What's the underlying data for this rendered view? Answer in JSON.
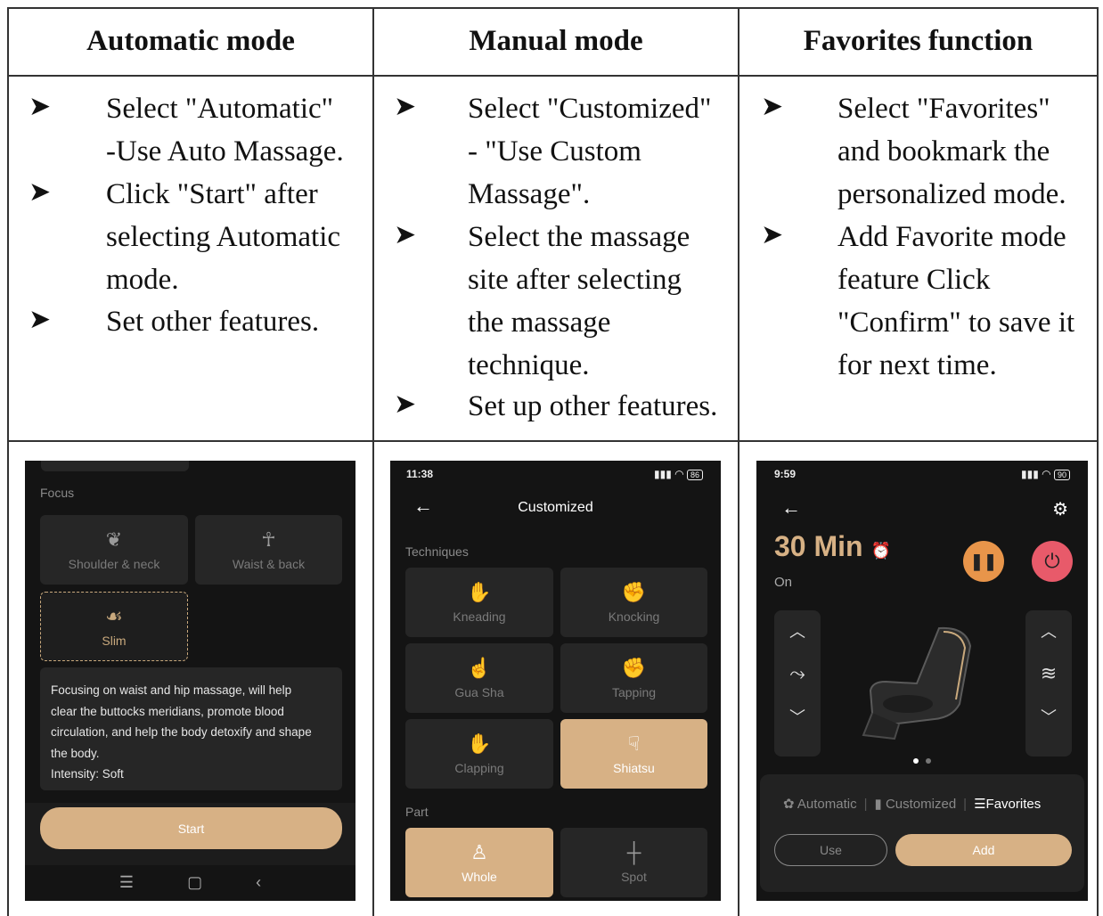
{
  "columns": [
    {
      "header": "Automatic mode",
      "bullets": [
        [
          "Select \"Automatic\"",
          "-Use Auto Massage."
        ],
        [
          "Click \"Start\" after",
          "selecting Automatic",
          "mode."
        ],
        [
          "Set other features."
        ]
      ]
    },
    {
      "header": "Manual mode",
      "bullets": [
        [
          "Select \"Customized\"",
          "- \"Use Custom",
          "Massage\"."
        ],
        [
          "Select the massage",
          "site after selecting",
          "the massage",
          "technique."
        ],
        [
          "Set up other features."
        ]
      ]
    },
    {
      "header": "Favorites function",
      "bullets": [
        [
          "Select \"Favorites\"",
          "and bookmark the",
          "personalized mode."
        ],
        [
          "Add Favorite mode",
          "feature Click",
          "\"Confirm\" to save it",
          "for next time."
        ]
      ]
    }
  ],
  "phone1": {
    "focus_label": "Focus",
    "cards": [
      "Shoulder & neck",
      "Waist & back",
      "Slim"
    ],
    "description": [
      "Focusing on waist and hip massage, will help",
      "clear the buttocks meridians, promote blood",
      "circulation, and help the body detoxify and shape",
      "the body.",
      "Intensity: Soft"
    ],
    "start_label": "Start",
    "nav": [
      "☰",
      "▢",
      "‹"
    ]
  },
  "phone2": {
    "time": "11:38",
    "battery": "86",
    "title": "Customized",
    "techniques_label": "Techniques",
    "techniques": [
      "Kneading",
      "Knocking",
      "Gua Sha",
      "Tapping",
      "Clapping",
      "Shiatsu"
    ],
    "part_label": "Part",
    "parts": [
      "Whole",
      "Spot"
    ]
  },
  "phone3": {
    "time": "9:59",
    "battery": "90",
    "duration": "30 Min",
    "state": "On",
    "tabs": [
      "Automatic",
      "Customized",
      "Favorites"
    ],
    "use_label": "Use",
    "add_label": "Add"
  },
  "colors": {
    "accent": "#d7b185",
    "pause": "#e8954a",
    "power": "#e85a6a"
  }
}
